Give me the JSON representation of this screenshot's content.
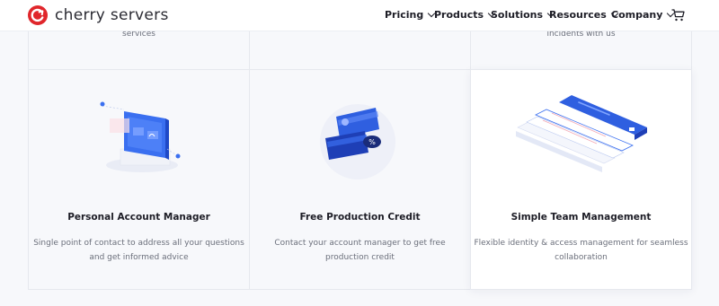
{
  "brand": {
    "name": "cherry servers",
    "accent": "#e0262b"
  },
  "nav": {
    "items": [
      {
        "label": "Pricing"
      },
      {
        "label": "Products"
      },
      {
        "label": "Solutions"
      },
      {
        "label": "Resources"
      },
      {
        "label": "Company"
      }
    ],
    "cart_icon": "cart-icon"
  },
  "top_row": {
    "left_snippet": "services",
    "right_snippet": "incidents with us"
  },
  "features": [
    {
      "title": "Personal Account Manager",
      "desc_line1": "Single point of contact to address all your questions",
      "desc_line2": "and get informed advice",
      "icon": "account-manager-illustration"
    },
    {
      "title": "Free Production Credit",
      "desc_line1": "Contact your account manager to get free",
      "desc_line2": "production credit",
      "icon": "credit-cards-illustration"
    },
    {
      "title": "Simple Team Management",
      "desc_line1": "Flexible identity & access management for seamless",
      "desc_line2": "collaboration",
      "icon": "team-management-illustration"
    }
  ],
  "colors": {
    "primary_blue": "#2f5fe0",
    "text": "#1d1d26",
    "muted": "#6b6f7b",
    "background": "#f7f8fb"
  }
}
